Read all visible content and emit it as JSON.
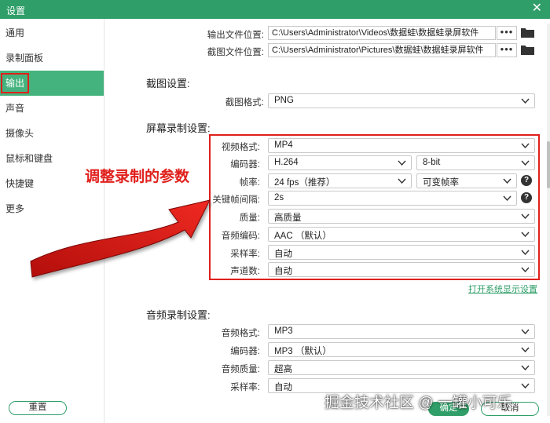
{
  "window": {
    "title": "设置",
    "close_glyph": "✕"
  },
  "sidebar": {
    "items": [
      {
        "label": "通用"
      },
      {
        "label": "录制面板"
      },
      {
        "label": "输出",
        "active": true
      },
      {
        "label": "声音"
      },
      {
        "label": "摄像头"
      },
      {
        "label": "鼠标和键盘"
      },
      {
        "label": "快捷键"
      },
      {
        "label": "更多"
      }
    ]
  },
  "output": {
    "video_folder": {
      "label": "输出文件位置:",
      "value": "C:\\Users\\Administrator\\Videos\\数据蛙\\数据蛙录屏软件",
      "more": "•••",
      "folder_icon": "folder-icon"
    },
    "screenshot_folder": {
      "label": "截图文件位置:",
      "value": "C:\\Users\\Administrator\\Pictures\\数据蛙\\数据蛙录屏软件",
      "more": "•••",
      "folder_icon": "folder-icon"
    }
  },
  "screenshot_settings": {
    "title": "截图设置:",
    "format": {
      "label": "截图格式:",
      "value": "PNG"
    }
  },
  "screen_recording": {
    "title": "屏幕录制设置:",
    "video_format": {
      "label": "视频格式:",
      "value": "MP4"
    },
    "encoder": {
      "label": "编码器:",
      "value": "H.264",
      "bit_depth": "8-bit"
    },
    "frame_rate": {
      "label": "帧率:",
      "value": "24 fps（推荐）",
      "mode": "可变帧率"
    },
    "keyframe_interval": {
      "label": "关键帧间隔:",
      "value": "2s"
    },
    "quality": {
      "label": "质量:",
      "value": "高质量"
    },
    "audio_codec": {
      "label": "音频编码:",
      "value": "AAC （默认）"
    },
    "sample_rate": {
      "label": "采样率:",
      "value": "自动"
    },
    "channels": {
      "label": "声道数:",
      "value": "自动"
    },
    "open_system_display": "打开系统显示设置",
    "help_glyph": "?"
  },
  "audio_recording": {
    "title": "音频录制设置:",
    "format": {
      "label": "音频格式:",
      "value": "MP3"
    },
    "encoder": {
      "label": "编码器:",
      "value": "MP3 （默认）"
    },
    "quality": {
      "label": "音频质量:",
      "value": "超高"
    },
    "sample_rate": {
      "label": "采样率:",
      "value": "自动"
    }
  },
  "annotation": {
    "text": "调整录制的参数",
    "color": "#e0201c"
  },
  "footer": {
    "reset": "重置",
    "confirm": "确定",
    "cancel": "取消"
  },
  "watermark": "掘金技术社区 @ 一罐小可乐",
  "colors": {
    "accent": "#2f9e68",
    "sidebar_active": "#45b37e",
    "highlight": "#e0201c"
  }
}
